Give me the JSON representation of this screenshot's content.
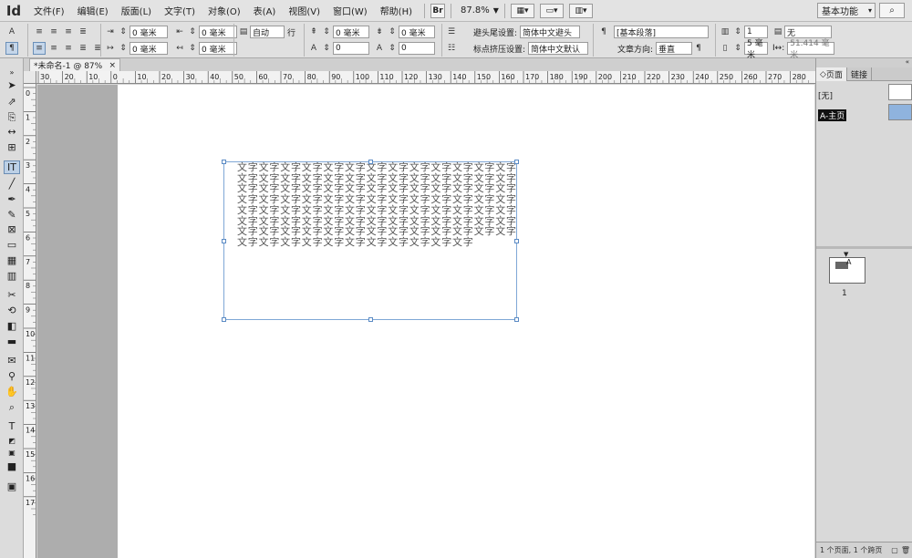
{
  "app": {
    "logo": "Id",
    "menus": [
      "文件(F)",
      "编辑(E)",
      "版面(L)",
      "文字(T)",
      "对象(O)",
      "表(A)",
      "视图(V)",
      "窗口(W)",
      "帮助(H)"
    ],
    "br_badge": "Br",
    "zoom": "87.8%",
    "workspace": "基本功能",
    "search_icon": "⌕"
  },
  "control_panel": {
    "char_mode": "A",
    "para_mode": "¶",
    "left_indent": "0 毫米",
    "right_indent": "0 毫米",
    "first_indent": "0 毫米",
    "last_indent": "0 毫米",
    "leading_mode": "自动",
    "leading_unit": "行",
    "space_before": "0 毫米",
    "space_after": "0 毫米",
    "dropcap_lines": "0",
    "dropcap_chars": "0",
    "kinsoku_label": "避头尾设置:",
    "kinsoku_value": "简体中文避头",
    "mojikumi_label": "标点挤压设置:",
    "mojikumi_value": "简体中文默认",
    "para_style": "[基本段落]",
    "story_direction_label": "文章方向:",
    "story_direction_value": "垂直",
    "columns": "1",
    "gutter": "5 毫米",
    "fill": "无",
    "width_value": "51.414 毫米",
    "width_label": "I↔:"
  },
  "document": {
    "tab_title": "*未命名-1 @ 87%",
    "close": "×",
    "frame_text_unit": "文字",
    "frame_text_repeat": 204
  },
  "rulers": {
    "top": [
      "30",
      "20",
      "10",
      "0",
      "10",
      "20",
      "30",
      "40",
      "50",
      "60",
      "70",
      "80",
      "90",
      "100",
      "110",
      "120",
      "130",
      "140",
      "150",
      "160",
      "170",
      "180",
      "190",
      "200",
      "210",
      "220",
      "230",
      "240",
      "250",
      "260",
      "270",
      "280"
    ],
    "left": [
      "0",
      "1",
      "2",
      "3",
      "4",
      "5",
      "6",
      "7",
      "8",
      "9",
      "10",
      "11",
      "12",
      "13",
      "14",
      "15",
      "16",
      "17"
    ]
  },
  "pages_panel": {
    "tabs": [
      "页面",
      "链接"
    ],
    "none_master": "[无]",
    "a_master": "A-主页",
    "page_number": "1",
    "thumb_label": "A",
    "footer": "1 个页面, 1 个跨页"
  }
}
